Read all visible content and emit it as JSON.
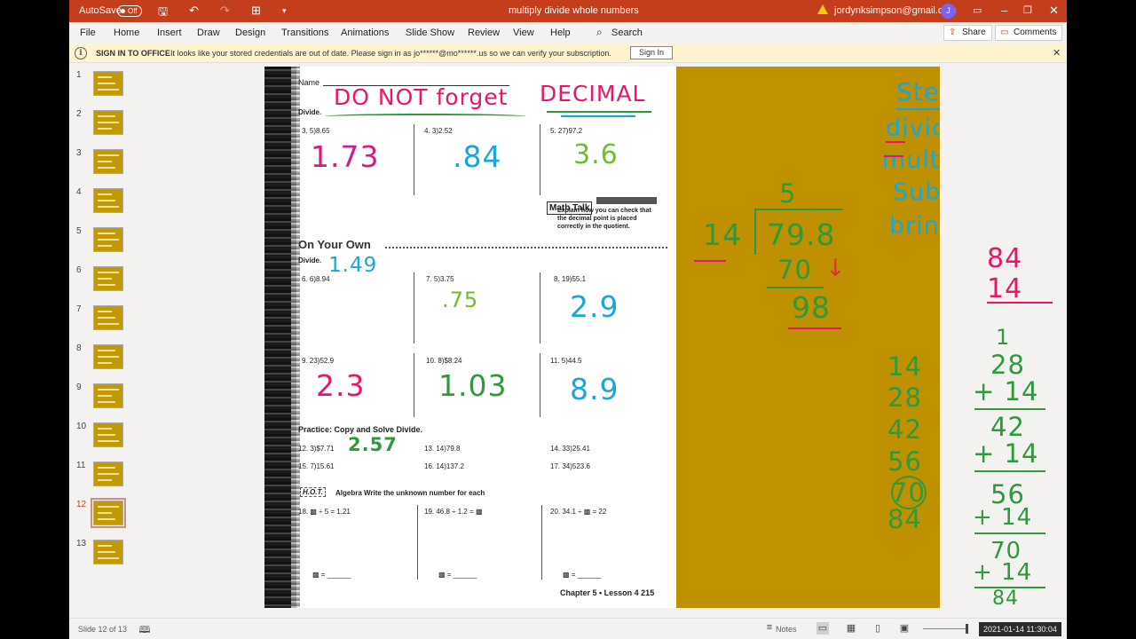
{
  "titlebar": {
    "autosave_label": "AutoSave",
    "autosave_state": "Off",
    "document_title": "multiply divide whole numbers",
    "account_email": "jordynksimpson@gmail.com",
    "avatar_initial": "J"
  },
  "ribbon": {
    "tabs": [
      "File",
      "Home",
      "Insert",
      "Draw",
      "Design",
      "Transitions",
      "Animations",
      "Slide Show",
      "Review",
      "View",
      "Help"
    ],
    "search_label": "Search",
    "share_label": "Share",
    "comments_label": "Comments"
  },
  "message_bar": {
    "title": "SIGN IN TO OFFICE",
    "text": "It looks like your stored credentials are out of date. Please sign in as jo******@mo******.us so we can verify your subscription.",
    "button_label": "Sign In"
  },
  "thumbnails": {
    "numbers": [
      "1",
      "2",
      "3",
      "4",
      "5",
      "6",
      "7",
      "8",
      "9",
      "10",
      "11",
      "12",
      "13"
    ],
    "selected": 12
  },
  "worksheet": {
    "name_label": "Name",
    "divide_label": "Divide.",
    "p3": "3.  5)8.65",
    "p4": "4.  3)2.52",
    "p5": "5.  27)97.2",
    "math_talk_title": "Math Talk",
    "math_talk_text": "Explain how you can check that the decimal point is placed correctly in the quotient.",
    "on_your_own": "On Your Own",
    "divide_label2": "Divide.",
    "p6": "6.  6)8.94",
    "p7": "7.  5)3.75",
    "p8": "8.  19)55.1",
    "p9": "9.  23)52.9",
    "p10": "10.  8)$8.24",
    "p11": "11.  5)44.5",
    "practice_label": "Practice: Copy and Solve  Divide.",
    "p12": "12.  3)$7.71",
    "p13": "13.  14)79.8",
    "p14": "14.  33)25.41",
    "p15": "15.  7)15.61",
    "p16": "16.  14)137.2",
    "p17": "17.  34)523.6",
    "hot_label": "H.O.T.",
    "algebra_text": "Algebra  Write the unknown number for each",
    "p18": "18.  ▩ ÷ 5 = 1.21",
    "p19": "19.  46.8 ÷ 1.2 = ▩",
    "p20": "20.  34.1 ÷ ▩ = 22",
    "blank18": "▩ = ______",
    "blank19": "▩ = ______",
    "blank20": "▩ = ______",
    "footer": "Chapter 5 • Lesson 4   215"
  },
  "annotations": {
    "headline_1": "DO NOT forget",
    "headline_2": "DECIMAL",
    "ans3": "1.73",
    "ans4": ".84",
    "ans5": "3.6",
    "ans6": "1.49",
    "ans7": ".75",
    "ans8": "2.9",
    "ans9": "2.3",
    "ans10": "1.03",
    "ans11": "8.9",
    "ans12": "2.57",
    "steps": [
      "Steps",
      "divide",
      "mult.",
      "Subt.",
      "bring ↓"
    ],
    "longdiv_quotient": "5",
    "longdiv_divisor": "14",
    "longdiv_dividend": "79.8",
    "longdiv_product": "70",
    "longdiv_remainder": "98",
    "mult_top": "84",
    "mult_bottom": "14",
    "multiples": [
      "14",
      "28",
      "42",
      "56",
      "70",
      "84"
    ],
    "addition": [
      "1",
      "28",
      "+ 14",
      "42",
      "+ 14",
      "56",
      "+ 14",
      "70",
      "+ 14",
      "84"
    ],
    "colors": {
      "pink": "#e8156a",
      "teal": "#1aa7d6",
      "green": "#2e9a3c",
      "lime": "#6cbf2a",
      "red": "#e0312b"
    }
  },
  "statusbar": {
    "slide_info": "Slide 12 of 13",
    "notes_label": "Notes",
    "timestamp": "2021-01-14 11:30:04"
  }
}
